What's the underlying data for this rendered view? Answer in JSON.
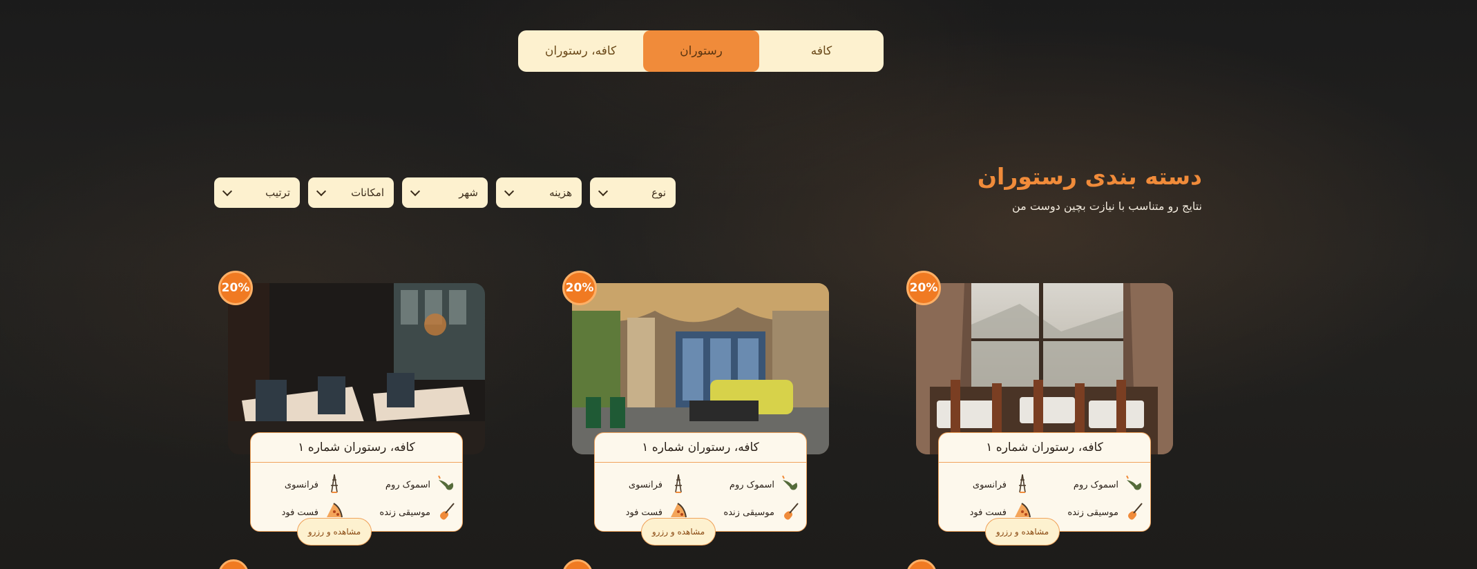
{
  "tabs": [
    {
      "label": "کافه"
    },
    {
      "label": "رستوران"
    },
    {
      "label": "کافه، رستوران"
    }
  ],
  "section": {
    "title": "دسته بندی رستوران",
    "subtitle": "نتایج رو متناسب با نیازت بچین دوست من"
  },
  "filters": [
    {
      "label": "نوع"
    },
    {
      "label": "هزینه"
    },
    {
      "label": "شهر"
    },
    {
      "label": "امکانات"
    },
    {
      "label": "ترتیب"
    }
  ],
  "cards": [
    {
      "discount": "20%",
      "title": "کافه، رستوران شماره ۱",
      "features": [
        "اسموک روم",
        "فرانسوی",
        "موسیقی زنده",
        "فست فود"
      ],
      "button": "مشاهده و رزرو"
    },
    {
      "discount": "20%",
      "title": "کافه، رستوران شماره ۱",
      "features": [
        "اسموک روم",
        "فرانسوی",
        "موسیقی زنده",
        "فست فود"
      ],
      "button": "مشاهده و رزرو"
    },
    {
      "discount": "20%",
      "title": "کافه، رستوران شماره ۱",
      "features": [
        "اسموک روم",
        "فرانسوی",
        "موسیقی زنده",
        "فست فود"
      ],
      "button": "مشاهده و رزرو"
    }
  ],
  "icons": {
    "smoke": "smoking-pipe-icon",
    "french": "eiffel-tower-icon",
    "music": "guitar-icon",
    "fastfood": "pizza-slice-icon"
  },
  "colors": {
    "accent": "#f08b3a",
    "panel": "#fdf1cf"
  }
}
